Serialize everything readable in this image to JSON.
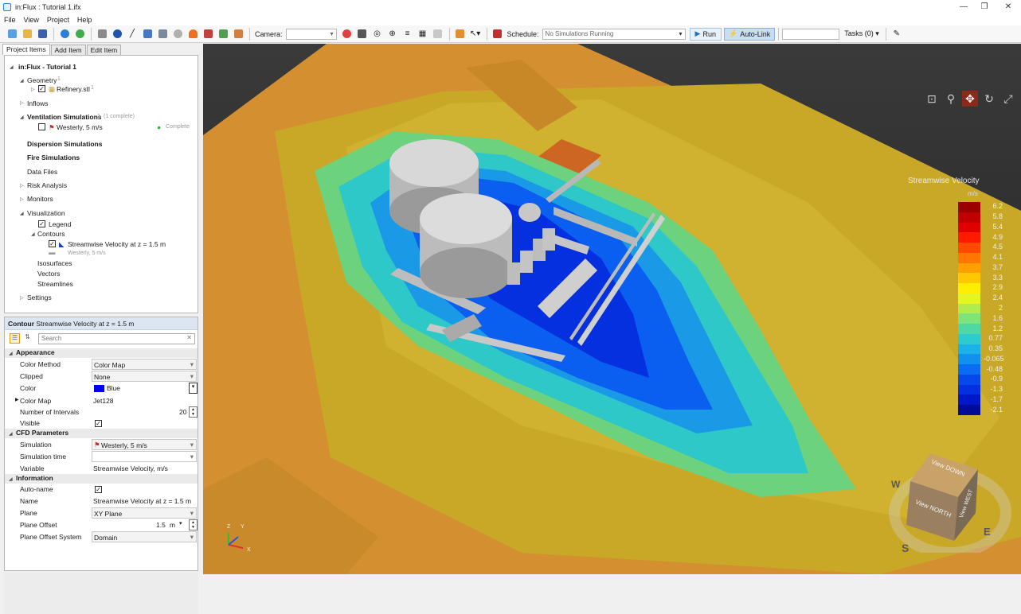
{
  "window": {
    "title": "in:Flux : Tutorial 1.ifx"
  },
  "menu": [
    "File",
    "View",
    "Project",
    "Help"
  ],
  "toolbar": {
    "camera_label": "Camera:",
    "schedule_label": "Schedule:",
    "schedule_value": "No Simulations Running",
    "run_label": "Run",
    "autolink_label": "Auto-Link",
    "tasks_label": "Tasks (0)"
  },
  "tabs": [
    "Project Items",
    "Add Item",
    "Edit Item"
  ],
  "tree": {
    "root": "in:Flux - Tutorial 1",
    "geometry": "Geometry",
    "geometry_count": "1",
    "refinery": "Refinery.stl",
    "refinery_count": "1",
    "inflows": "Inflows",
    "ventilation": "Ventilation Simulations",
    "ventilation_note": "(1 complete)",
    "ventilation_count": "1",
    "westerly": "Westerly, 5 m/s",
    "complete": "Complete",
    "dispersion": "Dispersion Simulations",
    "fire": "Fire Simulations",
    "datafiles": "Data Files",
    "risk": "Risk Analysis",
    "monitors": "Monitors",
    "visualization": "Visualization",
    "legend": "Legend",
    "contours": "Contours",
    "contour_item": "Streamwise Velocity at z = 1.5 m",
    "contour_sub": "Westerly, 5 m/s",
    "isosurfaces": "Isosurfaces",
    "vectors": "Vectors",
    "streamlines": "Streamlines",
    "settings": "Settings"
  },
  "props": {
    "header_type": "Contour",
    "header_name": "Streamwise Velocity at z = 1.5 m",
    "search_placeholder": "Search",
    "appearance": "Appearance",
    "color_method_l": "Color Method",
    "color_method_v": "Color Map",
    "clipped_l": "Clipped",
    "clipped_v": "None",
    "color_l": "Color",
    "color_v": "Blue",
    "colormap_l": "Color Map",
    "colormap_v": "Jet128",
    "intervals_l": "Number of Intervals",
    "intervals_v": "20",
    "visible_l": "Visible",
    "cfd": "CFD Parameters",
    "simulation_l": "Simulation",
    "simulation_v": "Westerly, 5 m/s",
    "simtime_l": "Simulation time",
    "variable_l": "Variable",
    "variable_v": "Streamwise Velocity, m/s",
    "information": "Information",
    "autoname_l": "Auto-name",
    "name_l": "Name",
    "name_v": "Streamwise Velocity at z = 1.5 m",
    "plane_l": "Plane",
    "plane_v": "XY Plane",
    "offset_l": "Plane Offset",
    "offset_v": "1.5",
    "offset_unit": "m",
    "offsetsys_l": "Plane Offset System",
    "offsetsys_v": "Domain"
  },
  "legend": {
    "title": "Streamwise Velocity",
    "unit": "m/s",
    "ticks": [
      "6.2",
      "5.8",
      "5.4",
      "4.9",
      "4.5",
      "4.1",
      "3.7",
      "3.3",
      "2.9",
      "2.4",
      "2",
      "1.6",
      "1.2",
      "0.77",
      "0.35",
      "-0.065",
      "-0.48",
      "-0.9",
      "-1.3",
      "-1.7",
      "-2.1"
    ],
    "colors": [
      "#9b0000",
      "#c00000",
      "#e00000",
      "#ff1a00",
      "#ff4a00",
      "#ff7700",
      "#ffa000",
      "#ffc800",
      "#ffee00",
      "#e4f522",
      "#b2ec4c",
      "#7ee27d",
      "#4fd8a6",
      "#2dcad0",
      "#1ab2e8",
      "#1190f0",
      "#0a6cf2",
      "#0648ec",
      "#0330e0",
      "#0018c8",
      "#000c98"
    ]
  },
  "viewcube": {
    "top": "View DOWN",
    "front": "View NORTH",
    "side": "View WEST"
  },
  "compass": {
    "s": "S",
    "e": "E",
    "w": "W"
  },
  "axes": {
    "x": "X",
    "y": "Y",
    "z": "Z"
  }
}
